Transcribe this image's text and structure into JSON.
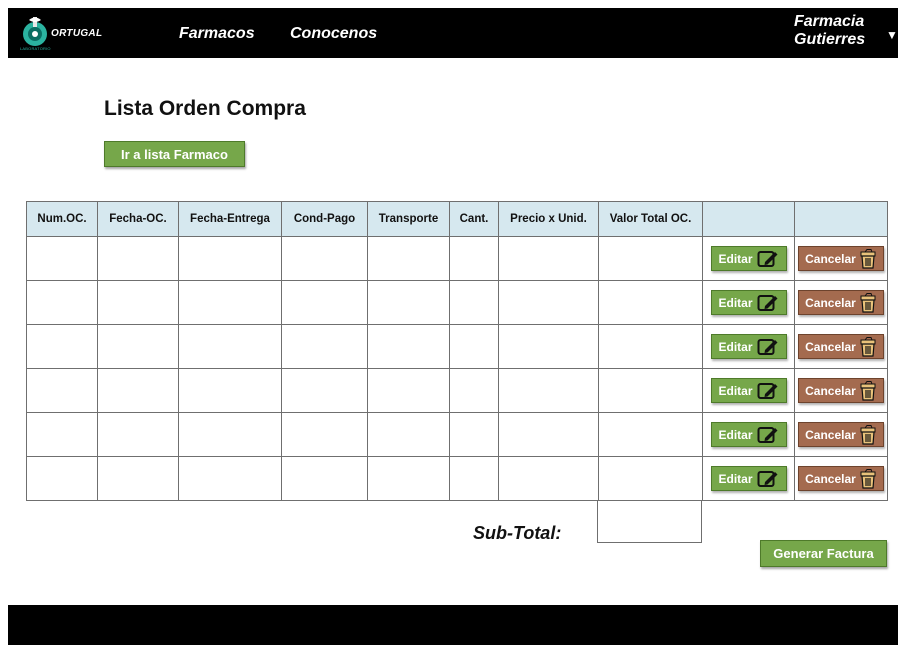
{
  "brand": {
    "logo_text": "ORTUGAL",
    "logo_subtext": "LABORATORIO"
  },
  "nav": {
    "links": [
      "Farmacos",
      "Conocenos"
    ]
  },
  "user": {
    "name": "Farmacia Gutierres"
  },
  "page": {
    "title": "Lista Orden Compra",
    "ir_lista_label": "Ir a lista Farmaco"
  },
  "table": {
    "headers": [
      "Num.OC.",
      "Fecha-OC.",
      "Fecha-Entrega",
      "Cond-Pago",
      "Transporte",
      "Cant.",
      "Precio x Unid.",
      "Valor Total  OC.",
      "",
      ""
    ],
    "rows": [
      [
        "",
        "",
        "",
        "",
        "",
        "",
        "",
        ""
      ],
      [
        "",
        "",
        "",
        "",
        "",
        "",
        "",
        ""
      ],
      [
        "",
        "",
        "",
        "",
        "",
        "",
        "",
        ""
      ],
      [
        "",
        "",
        "",
        "",
        "",
        "",
        "",
        ""
      ],
      [
        "",
        "",
        "",
        "",
        "",
        "",
        "",
        ""
      ],
      [
        "",
        "",
        "",
        "",
        "",
        "",
        "",
        ""
      ]
    ],
    "edit_label": "Editar",
    "cancel_label": "Cancelar"
  },
  "subtotal": {
    "label": "Sub-Total:",
    "value": ""
  },
  "actions": {
    "generar_factura": "Generar Factura"
  },
  "colors": {
    "nav_bg": "#000000",
    "green": "#76a74a",
    "brown": "#a46b4f",
    "table_header_bg": "#d6e8ef"
  },
  "icons": {
    "edit": "edit-pencil-icon",
    "cancel": "trash-icon",
    "menu": "caret-down-icon"
  }
}
